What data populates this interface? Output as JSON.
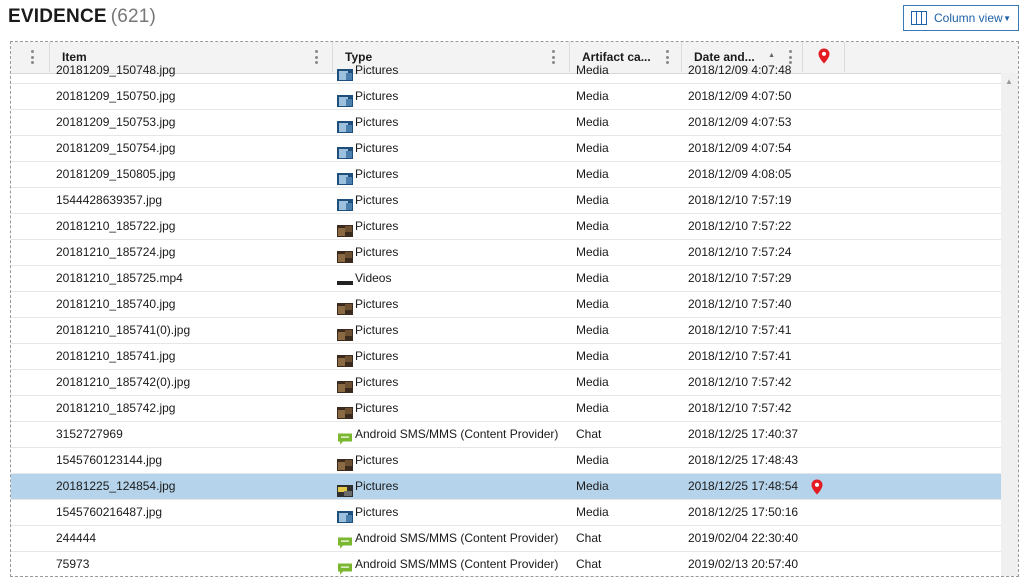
{
  "header": {
    "title": "EVIDENCE",
    "count": "(621)"
  },
  "toolbar": {
    "column_view_label": "Column view"
  },
  "colors": {
    "accent": "#1d62a8",
    "pin": "#e31b23",
    "selected_row": "#b5d3ea"
  },
  "columns": [
    {
      "label": "Item"
    },
    {
      "label": "Type"
    },
    {
      "label": "Artifact ca..."
    },
    {
      "label": "Date and..."
    }
  ],
  "rows": [
    {
      "item": "20181209_150748.jpg",
      "type": "Pictures",
      "icon": "pictures-blue-icon",
      "category": "Media",
      "date": "2018/12/09 4:07:48",
      "pin": false,
      "selected": false
    },
    {
      "item": "20181209_150750.jpg",
      "type": "Pictures",
      "icon": "pictures-blue-icon",
      "category": "Media",
      "date": "2018/12/09 4:07:50",
      "pin": false,
      "selected": false
    },
    {
      "item": "20181209_150753.jpg",
      "type": "Pictures",
      "icon": "pictures-blue-icon",
      "category": "Media",
      "date": "2018/12/09 4:07:53",
      "pin": false,
      "selected": false
    },
    {
      "item": "20181209_150754.jpg",
      "type": "Pictures",
      "icon": "pictures-blue-icon",
      "category": "Media",
      "date": "2018/12/09 4:07:54",
      "pin": false,
      "selected": false
    },
    {
      "item": "20181209_150805.jpg",
      "type": "Pictures",
      "icon": "pictures-blue-icon",
      "category": "Media",
      "date": "2018/12/09 4:08:05",
      "pin": false,
      "selected": false
    },
    {
      "item": "1544428639357.jpg",
      "type": "Pictures",
      "icon": "pictures-blue-icon",
      "category": "Media",
      "date": "2018/12/10 7:57:19",
      "pin": false,
      "selected": false
    },
    {
      "item": "20181210_185722.jpg",
      "type": "Pictures",
      "icon": "pictures-brown-icon",
      "category": "Media",
      "date": "2018/12/10 7:57:22",
      "pin": false,
      "selected": false
    },
    {
      "item": "20181210_185724.jpg",
      "type": "Pictures",
      "icon": "pictures-brown-icon",
      "category": "Media",
      "date": "2018/12/10 7:57:24",
      "pin": false,
      "selected": false
    },
    {
      "item": "20181210_185725.mp4",
      "type": "Videos",
      "icon": "videos-icon",
      "category": "Media",
      "date": "2018/12/10 7:57:29",
      "pin": false,
      "selected": false
    },
    {
      "item": "20181210_185740.jpg",
      "type": "Pictures",
      "icon": "pictures-brown-icon",
      "category": "Media",
      "date": "2018/12/10 7:57:40",
      "pin": false,
      "selected": false
    },
    {
      "item": "20181210_185741(0).jpg",
      "type": "Pictures",
      "icon": "pictures-brown-icon",
      "category": "Media",
      "date": "2018/12/10 7:57:41",
      "pin": false,
      "selected": false
    },
    {
      "item": "20181210_185741.jpg",
      "type": "Pictures",
      "icon": "pictures-brown-icon",
      "category": "Media",
      "date": "2018/12/10 7:57:41",
      "pin": false,
      "selected": false
    },
    {
      "item": "20181210_185742(0).jpg",
      "type": "Pictures",
      "icon": "pictures-brown-icon",
      "category": "Media",
      "date": "2018/12/10 7:57:42",
      "pin": false,
      "selected": false
    },
    {
      "item": "20181210_185742.jpg",
      "type": "Pictures",
      "icon": "pictures-brown-icon",
      "category": "Media",
      "date": "2018/12/10 7:57:42",
      "pin": false,
      "selected": false
    },
    {
      "item": "3152727969",
      "type": "Android SMS/MMS (Content Provider)",
      "icon": "chat-icon",
      "category": "Chat",
      "date": "2018/12/25 17:40:37",
      "pin": false,
      "selected": false
    },
    {
      "item": "1545760123144.jpg",
      "type": "Pictures",
      "icon": "pictures-brown-icon",
      "category": "Media",
      "date": "2018/12/25 17:48:43",
      "pin": false,
      "selected": false
    },
    {
      "item": "20181225_124854.jpg",
      "type": "Pictures",
      "icon": "pictures-yellow-icon",
      "category": "Media",
      "date": "2018/12/25 17:48:54",
      "pin": true,
      "selected": true
    },
    {
      "item": "1545760216487.jpg",
      "type": "Pictures",
      "icon": "pictures-blue-icon",
      "category": "Media",
      "date": "2018/12/25 17:50:16",
      "pin": false,
      "selected": false
    },
    {
      "item": "244444",
      "type": "Android SMS/MMS (Content Provider)",
      "icon": "chat-icon",
      "category": "Chat",
      "date": "2019/02/04 22:30:40",
      "pin": false,
      "selected": false
    },
    {
      "item": "75973",
      "type": "Android SMS/MMS (Content Provider)",
      "icon": "chat-icon",
      "category": "Chat",
      "date": "2019/02/13 20:57:40",
      "pin": false,
      "selected": false
    }
  ]
}
